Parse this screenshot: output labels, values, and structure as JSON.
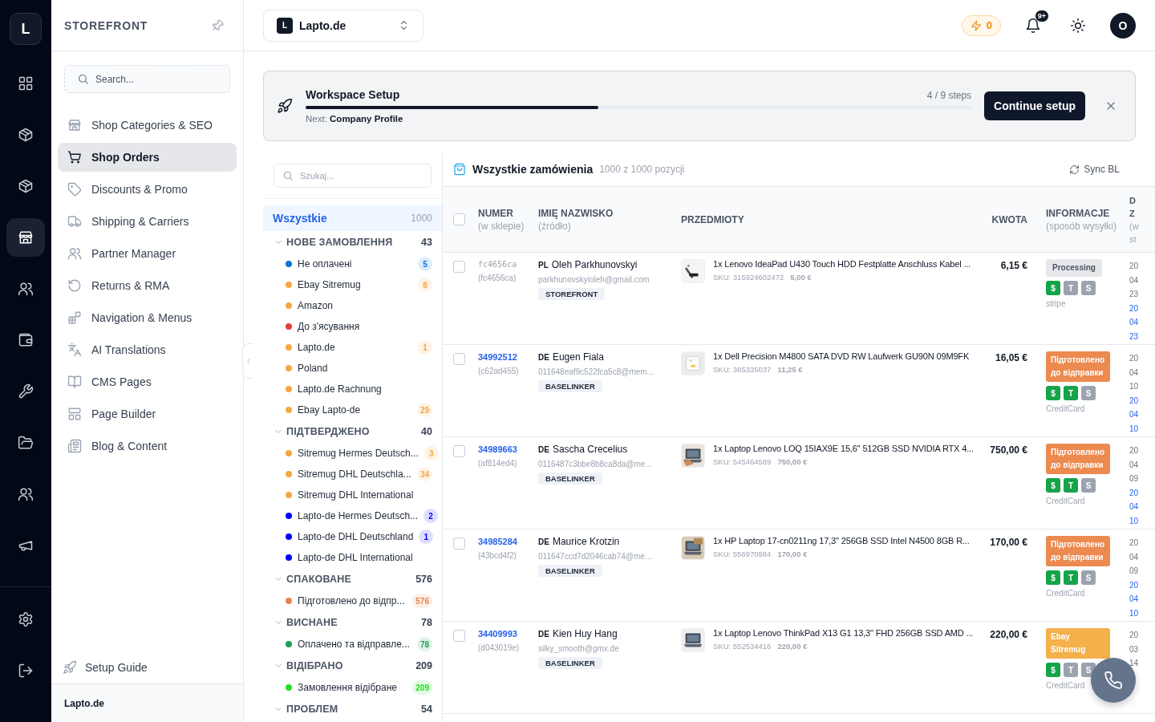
{
  "rail": {
    "logo": "L",
    "items": [
      {
        "selected": false
      },
      {
        "selected": false
      },
      {
        "selected": false
      },
      {
        "selected": true
      },
      {
        "selected": false
      },
      {
        "selected": false
      },
      {
        "selected": false
      },
      {
        "selected": false
      },
      {
        "selected": false
      },
      {
        "selected": false
      }
    ]
  },
  "sidebar": {
    "title": "STOREFRONT",
    "search": {
      "placeholder": "Search..."
    },
    "items": [
      {
        "label": "Shop Categories & SEO",
        "selected": false
      },
      {
        "label": "Shop Orders",
        "selected": true
      },
      {
        "label": "Discounts & Promo",
        "selected": false
      },
      {
        "label": "Shipping & Carriers",
        "selected": false
      },
      {
        "label": "Partner Manager",
        "selected": false
      },
      {
        "label": "Returns & RMA",
        "selected": false
      },
      {
        "label": "Navigation & Menus",
        "selected": false
      },
      {
        "label": "AI Translations",
        "selected": false
      },
      {
        "label": "CMS Pages",
        "selected": false
      },
      {
        "label": "Page Builder",
        "selected": false
      },
      {
        "label": "Blog & Content",
        "selected": false
      }
    ],
    "setup_guide": "Setup Guide",
    "footer": "Lapto.de"
  },
  "topbar": {
    "store": {
      "initial": "L",
      "name": "Lapto.de"
    },
    "credits": "0",
    "notifications": "9+",
    "avatar": "O"
  },
  "setup": {
    "title": "Workspace Setup",
    "level": 0.44,
    "steps": "4 / 9 steps",
    "next": "Next: **Company Profile**",
    "button": "Continue setup"
  },
  "statuses": {
    "search": {
      "placeholder": "Szukaj..."
    },
    "all": {
      "label": "Wszystkie",
      "count": "1000",
      "selected": true
    },
    "groups": [
      {
        "name": "НОВЕ ЗАМОВЛЕННЯ",
        "count": "43",
        "expanded": true,
        "items": [
          {
            "label": "Не оплачені",
            "color": "#0b72d9",
            "count": "5",
            "selected": false
          },
          {
            "label": "Ebay Sitremug",
            "color": "#f5a742",
            "count": "8",
            "selected": false
          },
          {
            "label": "Amazon",
            "color": "#f5a742",
            "selected": false
          },
          {
            "label": "До з'ясування",
            "color": "#e53e3e",
            "selected": false
          },
          {
            "label": "Lapto.de",
            "color": "#f5a742",
            "count": "1",
            "selected": false
          },
          {
            "label": "Poland",
            "color": "#f5a742",
            "selected": false
          },
          {
            "label": "Lapto.de Rachnung",
            "color": "#f5a742",
            "selected": false
          },
          {
            "label": "Ebay Lapto-de",
            "color": "#f5a742",
            "count": "29",
            "selected": false
          }
        ]
      },
      {
        "name": "ПІДТВЕРДЖЕНО",
        "count": "40",
        "expanded": true,
        "items": [
          {
            "label": "Sitremug Hermes Deutsch...",
            "color": "#f5a742",
            "count": "3",
            "selected": false
          },
          {
            "label": "Sitremug DHL Deutschla...",
            "color": "#f5a742",
            "count": "34",
            "selected": false
          },
          {
            "label": "Sitremug DHL International",
            "color": "#f5a742",
            "selected": false
          },
          {
            "label": "Lapto-de Hermes Deutsch...",
            "color": "#0000ff",
            "count": "2",
            "selected": false
          },
          {
            "label": "Lapto-de DHL Deutschland",
            "color": "#0000ff",
            "count": "1",
            "selected": false
          },
          {
            "label": "Lapto-de DHL International",
            "color": "#0000ff",
            "selected": false
          }
        ]
      },
      {
        "name": "СПАКОВАНЕ",
        "count": "576",
        "expanded": true,
        "items": [
          {
            "label": "Підготовлено до відпр...",
            "color": "#e8834e",
            "count": "576",
            "selected": false
          }
        ]
      },
      {
        "name": "ВИСНАНЕ",
        "count": "78",
        "expanded": true,
        "items": [
          {
            "label": "Оплачено та відправле...",
            "color": "#1e9e5a",
            "count": "78",
            "selected": false
          }
        ]
      },
      {
        "name": "ВІДІБРАНО",
        "count": "209",
        "expanded": true,
        "items": [
          {
            "label": "Замовлення відібране",
            "color": "#1fe01f",
            "count": "209",
            "selected": false
          }
        ]
      },
      {
        "name": "ПРОБЛЕМ",
        "count": "54",
        "expanded": true
      }
    ]
  },
  "orders": {
    "title": "Wszystkie zamówienia",
    "summary": "1000 z 1000 pozycji",
    "sync": "Sync BL",
    "select_all": {
      "checked": false
    },
    "columns": [
      {
        "title": "NUMER",
        "subtitle": "(w sklepie)"
      },
      {
        "title": "IMIĘ NAZWISKO",
        "subtitle": "(źródło)"
      },
      {
        "title": "PRZEDMIOTY"
      },
      {
        "title": "KWOTA"
      },
      {
        "title": "INFORMACJE",
        "subtitle": "(sposób wysyłki)"
      },
      {
        "title": "D Z",
        "subtitle": "(w st"
      }
    ],
    "rows": [
      {
        "checked": false,
        "number": "fc4656ca",
        "kind": "plain",
        "ref": "(fc4656ca)",
        "country": "PL",
        "name": "Oleh Parkhunovskyi",
        "email": "parkhunovskyioleh@gmail.com",
        "source": "STOREFRONT",
        "item": "1x Lenovo IdeaPad U430 Touch HDD Festplatte Anschluss Kabel ...",
        "sku": "SKU: 315924602472",
        "price": "5,00 €",
        "amount": "6,15 €",
        "status": {
          "label": "Processing",
          "color": "#e5e7eb"
        },
        "payment": [
          {
            "label": "$",
            "on": true
          },
          {
            "label": "T",
            "on": false
          },
          {
            "label": "S",
            "on": false
          }
        ],
        "method": "stripe",
        "date": "20 04 23",
        "date_link": "20 04 23"
      },
      {
        "checked": false,
        "number": "34992512",
        "kind": "link",
        "ref": "(c62ad455)",
        "country": "DE",
        "name": "Eugen Fiala",
        "email": "011648eaf9c522fca5c8@mem...",
        "source": "BASELINKER",
        "item": "1x Dell Precision M4800 SATA DVD RW Laufwerk GU90N 09M9FK",
        "sku": "SKU: 385335037",
        "price": "11,25 €",
        "amount": "16,05 €",
        "status": {
          "label": "Підготовлено до відправки",
          "color": "#ec8a4f"
        },
        "payment": [
          {
            "label": "$",
            "on": true
          },
          {
            "label": "T",
            "on": true
          },
          {
            "label": "S",
            "on": false
          }
        ],
        "method": "CreditCard",
        "date": "20 04 10",
        "date_link": "20 04 10"
      },
      {
        "checked": false,
        "number": "34989663",
        "kind": "link",
        "ref": "(af814ed4)",
        "country": "DE",
        "name": "Sascha Crecelius",
        "email": "0116487c3bbe8b8ca8da@me...",
        "source": "BASELINKER",
        "item": "1x Laptop Lenovo LOQ 15IAX9E 15,6\" 512GB SSD NVIDIA RTX 4...",
        "sku": "SKU: 545464589",
        "price": "750,00 €",
        "amount": "750,00 €",
        "status": {
          "label": "Підготовлено до відправки",
          "color": "#ec8a4f"
        },
        "payment": [
          {
            "label": "$",
            "on": true
          },
          {
            "label": "T",
            "on": true
          },
          {
            "label": "S",
            "on": false
          }
        ],
        "method": "CreditCard",
        "date": "20 04 09",
        "date_link": "20 04 10"
      },
      {
        "checked": false,
        "number": "34985284",
        "kind": "link",
        "ref": "(43bcd4f2)",
        "country": "DE",
        "name": "Maurice Krotzin",
        "email": "011647ccd7d2046cab74@me...",
        "source": "BASELINKER",
        "item": "1x HP Laptop 17-cn0211ng 17,3\" 256GB SSD Intel N4500 8GB R...",
        "sku": "SKU: 556970984",
        "price": "170,00 €",
        "amount": "170,00 €",
        "status": {
          "label": "Підготовлено до відправки",
          "color": "#ec8a4f"
        },
        "payment": [
          {
            "label": "$",
            "on": true
          },
          {
            "label": "T",
            "on": true
          },
          {
            "label": "S",
            "on": false
          }
        ],
        "method": "CreditCard",
        "date": "20 04 09",
        "date_link": "20 04 10"
      },
      {
        "checked": false,
        "number": "34409993",
        "kind": "link",
        "ref": "(d043019e)",
        "country": "DE",
        "name": "Kien Huy Hang",
        "email": "silky_smooth@gmx.de",
        "source": "BASELINKER",
        "item": "1x Laptop Lenovo ThinkPad X13 G1 13,3\" FHD 256GB SSD AMD ...",
        "sku": "SKU: 552534416",
        "price": "220,00 €",
        "amount": "220,00 €",
        "status": {
          "label": "Ebay Sitremug",
          "color": "#f4b04a"
        },
        "payment": [
          {
            "label": "$",
            "on": true
          },
          {
            "label": "T",
            "on": false
          },
          {
            "label": "S",
            "on": false
          }
        ],
        "method": "CreditCard",
        "date": "20 03 14"
      }
    ]
  }
}
